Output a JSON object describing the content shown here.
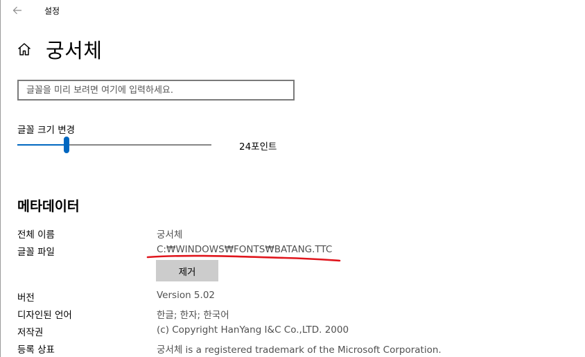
{
  "window": {
    "title": "설정"
  },
  "page": {
    "title": "궁서체"
  },
  "preview": {
    "placeholder": "글꼴을 미리 보려면 여기에 입력하세요."
  },
  "font_size": {
    "label": "글꼴 크기 변경",
    "value_text": "24포인트",
    "slider_fraction": 0.255
  },
  "metadata": {
    "section_title": "메타데이터",
    "full_name_label": "전체 이름",
    "full_name_value": "궁서체",
    "file_label": "글꼴 파일",
    "file_value": "C:₩WINDOWS₩FONTS₩BATANG.TTC",
    "remove_label": "제거",
    "version_label": "버전",
    "version_value": "Version 5.02",
    "languages_label": "디자인된 언어",
    "languages_value": "한글; 한자; 한국어",
    "copyright_label": "저작권",
    "copyright_value": "(c) Copyright HanYang I&C Co.,LTD. 2000",
    "trademark_label": "등록 상표",
    "trademark_value": "궁서체 is a registered trademark of the Microsoft Corporation."
  },
  "colors": {
    "accent": "#0067c0",
    "annotation": "#e0151c"
  },
  "icons": {
    "back": "arrow-left-icon",
    "home": "home-icon"
  }
}
